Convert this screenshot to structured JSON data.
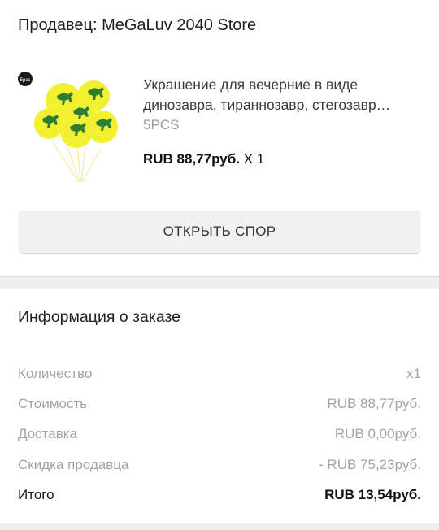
{
  "seller": {
    "title": "Продавец: MeGaLuv 2040 Store"
  },
  "product": {
    "name_line1": "Украшение для вечерние в виде",
    "name_line2": "динозавра, тираннозавр, стегозавр…",
    "variant": "5PCS",
    "price": "RUB 88,77руб.",
    "quantity": "X 1",
    "thumb_badge": "5pcs",
    "balloon_color": "#f3f032",
    "dino_color": "#2e7d32"
  },
  "dispute_button": {
    "label": "ОТКРЫТЬ СПОР"
  },
  "order_info": {
    "title": "Информация о заказе",
    "rows": [
      {
        "label": "Количество",
        "value": "x1"
      },
      {
        "label": "Стоимость",
        "value": "RUB 88,77руб."
      },
      {
        "label": "Доставка",
        "value": "RUB 0,00руб."
      },
      {
        "label": "Скидка продавца",
        "value": "- RUB 75,23руб."
      },
      {
        "label": "Итого",
        "value": "RUB 13,54руб."
      }
    ]
  }
}
